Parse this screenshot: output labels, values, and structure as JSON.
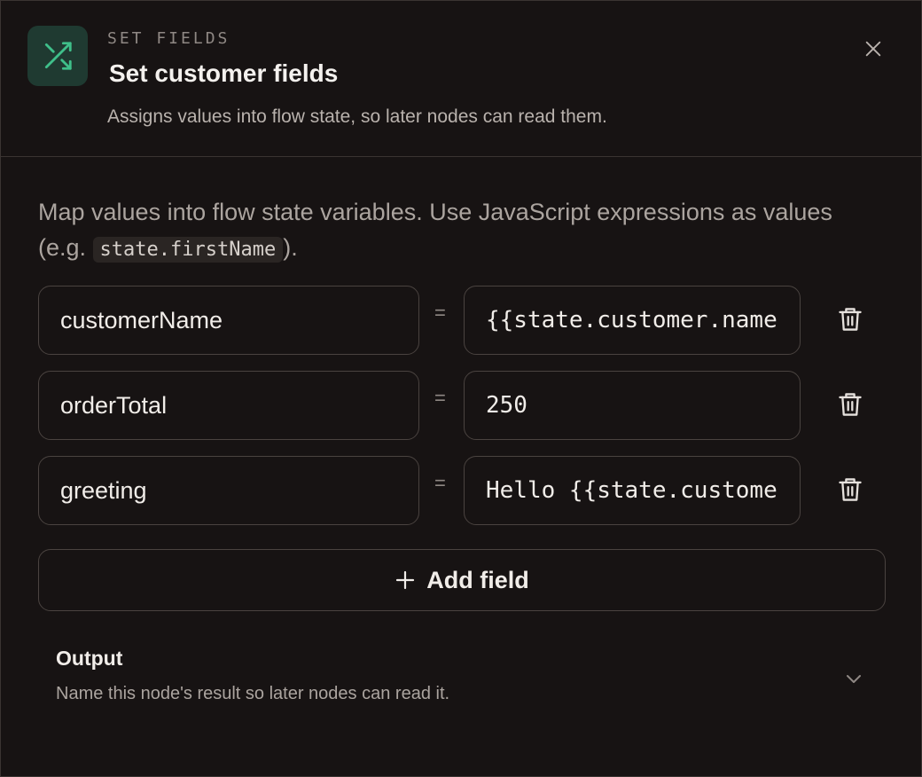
{
  "header": {
    "eyebrow": "SET FIELDS",
    "title": "Set customer fields",
    "subtitle": "Assigns values into flow state, so later nodes can read them.",
    "accent_color": "#3fbf8a",
    "icon": "shuffle-icon"
  },
  "description": {
    "text_before": "Map values into flow state variables. Use JavaScript expressions as values (e.g. ",
    "code": "state.firstName",
    "text_after": ")."
  },
  "fields": [
    {
      "key": "customerName",
      "separator": "=",
      "value": "{{state.customer.name}}"
    },
    {
      "key": "orderTotal",
      "separator": "=",
      "value": "250"
    },
    {
      "key": "greeting",
      "separator": "=",
      "value": "Hello {{state.customer.name}}"
    }
  ],
  "add_field": {
    "label": "Add field",
    "icon": "plus-icon"
  },
  "output": {
    "title": "Output",
    "description": "Name this node's result so later nodes can read it.",
    "icon": "chevron-down-icon"
  },
  "icons": {
    "close": "close-icon",
    "delete": "trash-icon"
  }
}
